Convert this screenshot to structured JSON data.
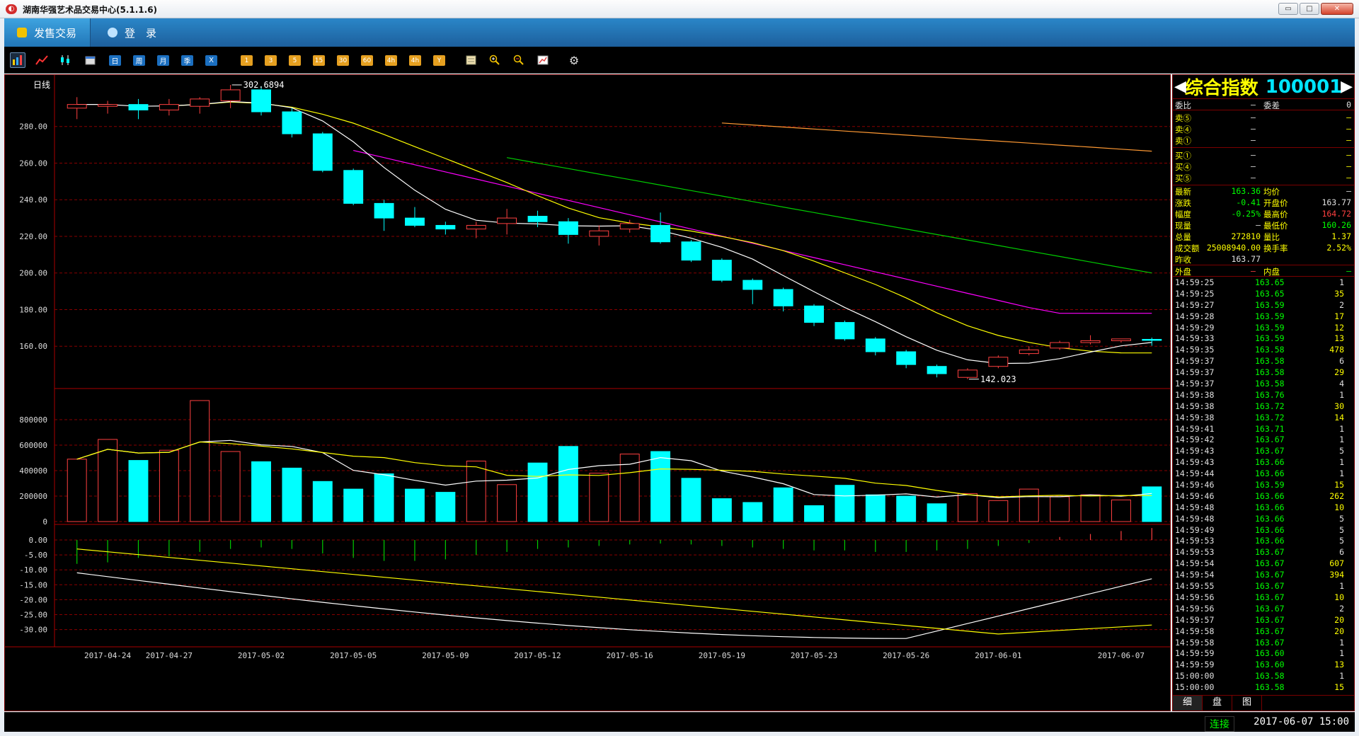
{
  "window": {
    "title": "湖南华强艺术品交易中心(5.1.1.6)",
    "min_label": "▭",
    "max_label": "□",
    "close_label": "✕"
  },
  "menubar": {
    "items": [
      {
        "label": "发售交易"
      },
      {
        "label": "登　录"
      }
    ]
  },
  "toolbar": {
    "icons": [
      "kline-icon",
      "line-icon",
      "candles-icon",
      "calendar-icon"
    ],
    "period_buttons": [
      "日",
      "周",
      "月",
      "季",
      "X"
    ],
    "interval_buttons": [
      "1",
      "3",
      "5",
      "15",
      "30",
      "60",
      "4h",
      "4h",
      "Y"
    ],
    "tool_icons": [
      "edit-icon",
      "zoom-in-icon",
      "zoom-out-icon",
      "draw-icon",
      "gear-icon"
    ]
  },
  "chart": {
    "period_label": "日线",
    "high_annotation": "302.6894",
    "low_annotation": "142.023",
    "price_axis": [
      "280.00",
      "260.00",
      "240.00",
      "220.00",
      "200.00",
      "180.00",
      "160.00"
    ],
    "volume_axis": [
      "800000",
      "600000",
      "400000",
      "200000",
      "0"
    ],
    "macd_axis": [
      "0.00",
      "-5.00",
      "-10.00",
      "-15.00",
      "-20.00",
      "-25.00",
      "-30.00"
    ],
    "date_labels": [
      "2017-04-24",
      "2017-04-27",
      "2017-05-02",
      "2017-05-05",
      "2017-05-09",
      "2017-05-12",
      "2017-05-16",
      "2017-05-19",
      "2017-05-23",
      "2017-05-26",
      "2017-06-01",
      "2017-06-07"
    ]
  },
  "chart_data": {
    "type": "candlestick",
    "title": "日线",
    "ylim": [
      140,
      305
    ],
    "candles": [
      {
        "open": 290,
        "close": 292,
        "high": 296,
        "low": 284
      },
      {
        "open": 291,
        "close": 292,
        "high": 294,
        "low": 287
      },
      {
        "open": 292,
        "close": 289,
        "high": 295,
        "low": 284
      },
      {
        "open": 289,
        "close": 292,
        "high": 295,
        "low": 286
      },
      {
        "open": 291,
        "close": 295,
        "high": 296,
        "low": 287
      },
      {
        "open": 294,
        "close": 300,
        "high": 302.69,
        "low": 290
      },
      {
        "open": 300,
        "close": 288,
        "high": 302,
        "low": 286
      },
      {
        "open": 288,
        "close": 276,
        "high": 290,
        "low": 274
      },
      {
        "open": 276,
        "close": 256,
        "high": 277,
        "low": 255
      },
      {
        "open": 256,
        "close": 238,
        "high": 257,
        "low": 237
      },
      {
        "open": 238,
        "close": 230,
        "high": 240,
        "low": 223
      },
      {
        "open": 230,
        "close": 226,
        "high": 236,
        "low": 225
      },
      {
        "open": 226,
        "close": 224,
        "high": 228,
        "low": 221
      },
      {
        "open": 224,
        "close": 226,
        "high": 228,
        "low": 219
      },
      {
        "open": 227,
        "close": 230,
        "high": 235,
        "low": 221
      },
      {
        "open": 231,
        "close": 228,
        "high": 234,
        "low": 225
      },
      {
        "open": 228,
        "close": 221,
        "high": 230,
        "low": 216
      },
      {
        "open": 220,
        "close": 223,
        "high": 226,
        "low": 215
      },
      {
        "open": 224,
        "close": 227,
        "high": 229,
        "low": 222
      },
      {
        "open": 226,
        "close": 217,
        "high": 233,
        "low": 216
      },
      {
        "open": 217,
        "close": 207,
        "high": 218,
        "low": 206
      },
      {
        "open": 207,
        "close": 196,
        "high": 208,
        "low": 195
      },
      {
        "open": 196,
        "close": 191,
        "high": 197,
        "low": 183
      },
      {
        "open": 191,
        "close": 182,
        "high": 192,
        "low": 179
      },
      {
        "open": 182,
        "close": 173,
        "high": 183,
        "low": 171
      },
      {
        "open": 173,
        "close": 164,
        "high": 174,
        "low": 163
      },
      {
        "open": 164,
        "close": 157,
        "high": 165,
        "low": 155
      },
      {
        "open": 157,
        "close": 150,
        "high": 158,
        "low": 148
      },
      {
        "open": 149,
        "close": 145,
        "high": 150,
        "low": 143
      },
      {
        "open": 143,
        "close": 147,
        "high": 148,
        "low": 142.02
      },
      {
        "open": 149,
        "close": 154,
        "high": 155,
        "low": 148
      },
      {
        "open": 156,
        "close": 158,
        "high": 160,
        "low": 155
      },
      {
        "open": 159,
        "close": 162,
        "high": 163,
        "low": 158
      },
      {
        "open": 162,
        "close": 163,
        "high": 166,
        "low": 161
      },
      {
        "open": 163,
        "close": 164,
        "high": 164,
        "low": 162
      },
      {
        "open": 163.77,
        "close": 163.36,
        "high": 164.72,
        "low": 160.26
      }
    ],
    "volume": [
      490000,
      645000,
      480000,
      560000,
      950000,
      550000,
      470000,
      420000,
      315000,
      255000,
      375000,
      255000,
      230000,
      475000,
      290000,
      460000,
      590000,
      380000,
      530000,
      550000,
      340000,
      180000,
      150000,
      265000,
      125000,
      285000,
      210000,
      200000,
      140000,
      220000,
      165000,
      255000,
      195000,
      210000,
      170000,
      272810
    ],
    "macd_bars": [
      -8,
      -7.5,
      -6,
      -5.5,
      -4,
      -3,
      -2.5,
      -3,
      -4.5,
      -6,
      -7,
      -7,
      -6.5,
      -5,
      -4,
      -3,
      -2.5,
      -2,
      -1.5,
      -1.2,
      -1.5,
      -2,
      -2.5,
      -3,
      -3.5,
      -3.5,
      -4,
      -4,
      -3.5,
      -3,
      -2,
      -1,
      1,
      2,
      3,
      4
    ]
  },
  "quote": {
    "name": "综合指数",
    "code": "100001",
    "left_arrow": "◀",
    "right_arrow": "▶",
    "ratio_label": "委比",
    "ratio_value": "—",
    "diff_label": "委差",
    "diff_value": "0",
    "sell_levels": [
      {
        "label": "卖⑤",
        "price": "—",
        "vol": "—"
      },
      {
        "label": "卖④",
        "price": "—",
        "vol": "—"
      },
      {
        "label": "卖①",
        "price": "—",
        "vol": "—"
      }
    ],
    "buy_levels": [
      {
        "label": "买①",
        "price": "—",
        "vol": "—"
      },
      {
        "label": "买④",
        "price": "—",
        "vol": "—"
      },
      {
        "label": "买⑤",
        "price": "—",
        "vol": "—"
      }
    ],
    "stats": [
      {
        "l1": "最新",
        "v1": "163.36",
        "l2": "均价",
        "v2": "—",
        "c1": "green",
        "c2": "white"
      },
      {
        "l1": "涨跌",
        "v1": "-0.41",
        "l2": "开盘价",
        "v2": "163.77",
        "c1": "green",
        "c2": "white"
      },
      {
        "l1": "幅度",
        "v1": "-0.25%",
        "l2": "最高价",
        "v2": "164.72",
        "c1": "green",
        "c2": "red"
      },
      {
        "l1": "现量",
        "v1": "—",
        "l2": "最低价",
        "v2": "160.26",
        "c1": "white",
        "c2": "green"
      },
      {
        "l1": "总量",
        "v1": "272810",
        "l2": "量比",
        "v2": "1.37",
        "c1": "yellow",
        "c2": "yellow"
      },
      {
        "l1": "成交额",
        "v1": "25008940.00",
        "l2": "换手率",
        "v2": "2.52%",
        "c1": "yellow",
        "c2": "yellow"
      },
      {
        "l1": "昨收",
        "v1": "163.77",
        "l2": "",
        "v2": "",
        "c1": "white",
        "c2": "white"
      }
    ],
    "outer_label": "外盘",
    "outer_value": "—",
    "inner_label": "内盘",
    "inner_value": "—",
    "ticks": [
      [
        "14:59:25",
        "163.65",
        "1"
      ],
      [
        "14:59:25",
        "163.65",
        "35"
      ],
      [
        "14:59:27",
        "163.59",
        "2"
      ],
      [
        "14:59:28",
        "163.59",
        "17"
      ],
      [
        "14:59:29",
        "163.59",
        "12"
      ],
      [
        "14:59:33",
        "163.59",
        "13"
      ],
      [
        "14:59:35",
        "163.58",
        "478"
      ],
      [
        "14:59:37",
        "163.58",
        "6"
      ],
      [
        "14:59:37",
        "163.58",
        "29"
      ],
      [
        "14:59:37",
        "163.58",
        "4"
      ],
      [
        "14:59:38",
        "163.76",
        "1"
      ],
      [
        "14:59:38",
        "163.72",
        "30"
      ],
      [
        "14:59:38",
        "163.72",
        "14"
      ],
      [
        "14:59:41",
        "163.71",
        "1"
      ],
      [
        "14:59:42",
        "163.67",
        "1"
      ],
      [
        "14:59:43",
        "163.67",
        "5"
      ],
      [
        "14:59:43",
        "163.66",
        "1"
      ],
      [
        "14:59:44",
        "163.66",
        "1"
      ],
      [
        "14:59:46",
        "163.59",
        "15"
      ],
      [
        "14:59:46",
        "163.66",
        "262"
      ],
      [
        "14:59:48",
        "163.66",
        "10"
      ],
      [
        "14:59:48",
        "163.66",
        "5"
      ],
      [
        "14:59:49",
        "163.66",
        "5"
      ],
      [
        "14:59:53",
        "163.66",
        "5"
      ],
      [
        "14:59:53",
        "163.67",
        "6"
      ],
      [
        "14:59:54",
        "163.67",
        "607"
      ],
      [
        "14:59:54",
        "163.67",
        "394"
      ],
      [
        "14:59:55",
        "163.67",
        "1"
      ],
      [
        "14:59:56",
        "163.67",
        "10"
      ],
      [
        "14:59:56",
        "163.67",
        "2"
      ],
      [
        "14:59:57",
        "163.67",
        "20"
      ],
      [
        "14:59:58",
        "163.67",
        "20"
      ],
      [
        "14:59:58",
        "163.67",
        "1"
      ],
      [
        "14:59:59",
        "163.60",
        "1"
      ],
      [
        "14:59:59",
        "163.60",
        "13"
      ],
      [
        "15:00:00",
        "163.58",
        "1"
      ],
      [
        "15:00:00",
        "163.58",
        "15"
      ]
    ],
    "tabs": [
      "细",
      "盘",
      "图"
    ]
  },
  "status": {
    "connection": "连接",
    "datetime": "2017-06-07 15:00"
  },
  "colors": {
    "up": "#ff4040",
    "down": "#00ffff",
    "ma5": "#ffffff",
    "ma10": "#ffff00",
    "ma20": "#ff00ff",
    "ma30": "#00cc00",
    "ma60": "#ff9933",
    "grid": "#880000"
  }
}
